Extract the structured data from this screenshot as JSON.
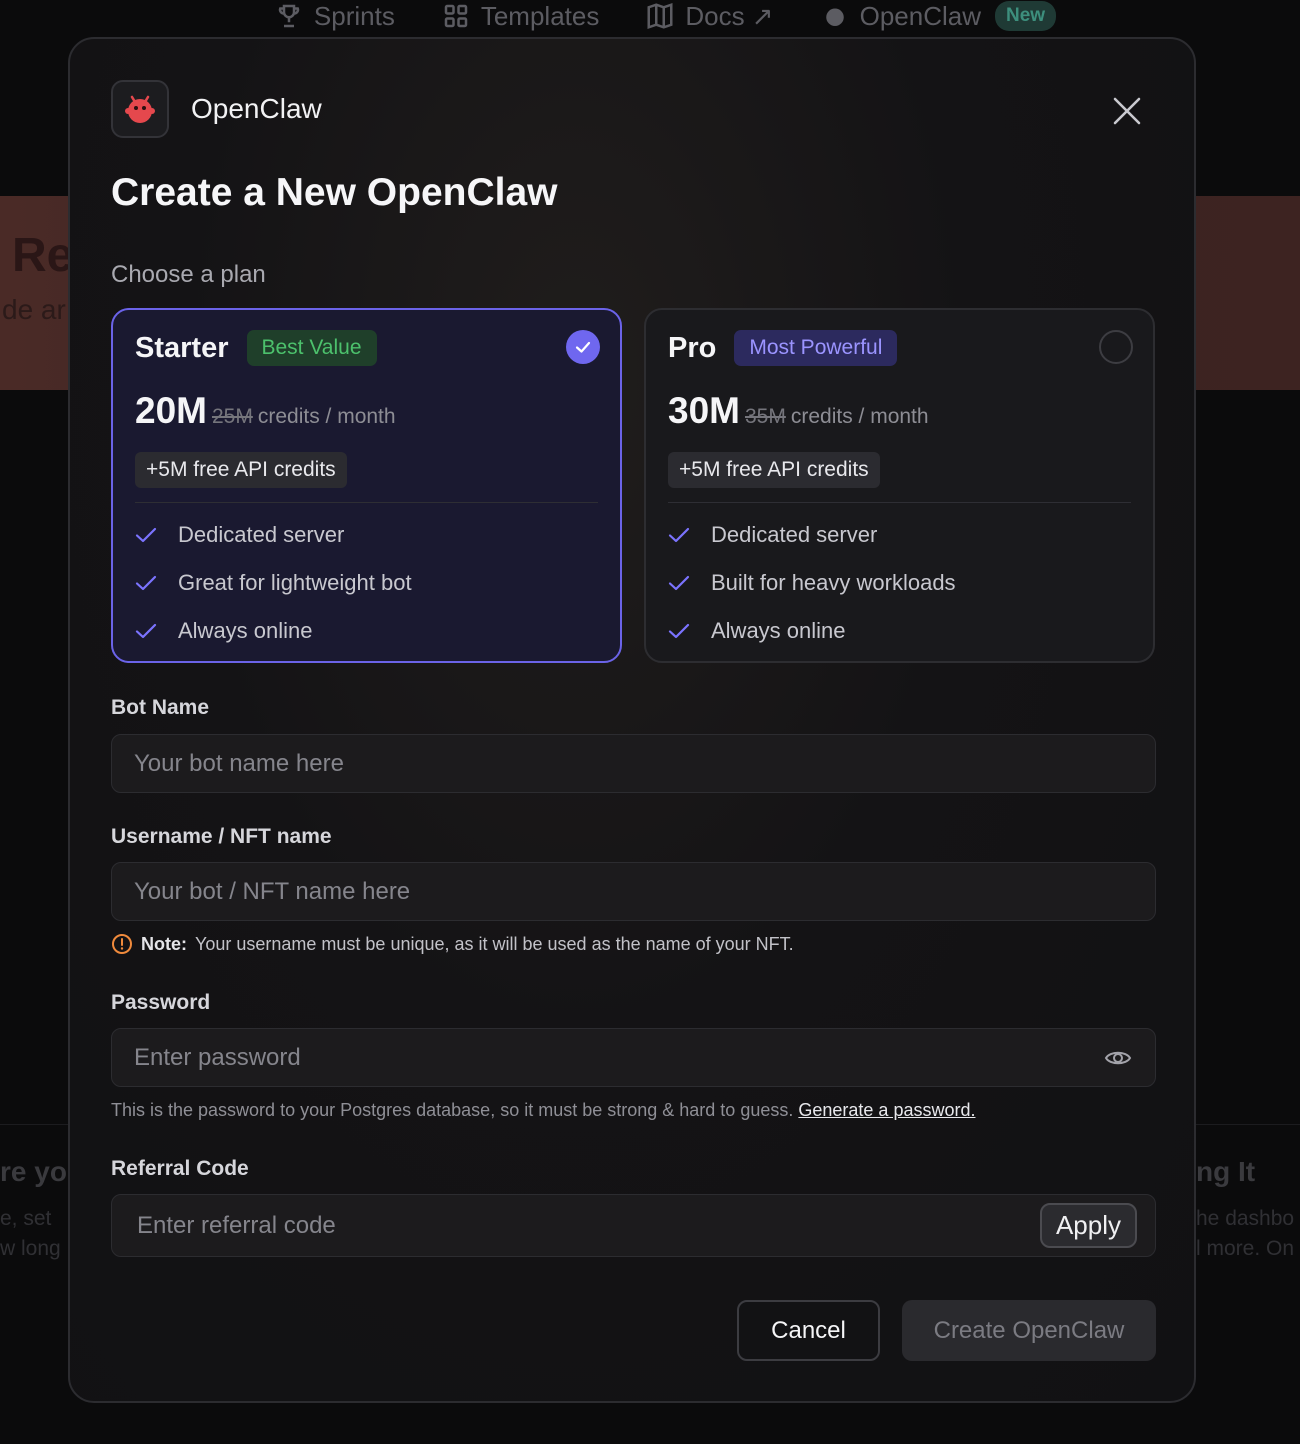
{
  "topnav": {
    "items": [
      {
        "label": "Sprints",
        "icon": "trophy-icon"
      },
      {
        "label": "Templates",
        "icon": "grid-icon"
      },
      {
        "label": "Docs ↗",
        "icon": "book-icon"
      },
      {
        "label": "OpenClaw",
        "icon": "bot-icon"
      }
    ],
    "new_badge": "New"
  },
  "background": {
    "title": "Re",
    "subtitle": "de ar",
    "left_heading": "re yo",
    "left_text": [
      "e, set",
      "w long"
    ],
    "right_heading": "ng It",
    "right_text": [
      "he dashbo",
      "l more. On"
    ]
  },
  "modal": {
    "app_name": "OpenClaw",
    "title": "Create a New OpenClaw",
    "plan_label": "Choose a plan",
    "plans": [
      {
        "name": "Starter",
        "badge": "Best Value",
        "selected": true,
        "credits": "20M",
        "old_credits": "25M",
        "unit": "credits / month",
        "api_bonus": "+5M free API credits",
        "features": [
          "Dedicated server",
          "Great for lightweight bot",
          "Always online"
        ]
      },
      {
        "name": "Pro",
        "badge": "Most Powerful",
        "selected": false,
        "credits": "30M",
        "old_credits": "35M",
        "unit": "credits / month",
        "api_bonus": "+5M free API credits",
        "features": [
          "Dedicated server",
          "Built for heavy workloads",
          "Always online"
        ]
      }
    ],
    "bot_name": {
      "label": "Bot Name",
      "placeholder": "Your bot name here",
      "value": ""
    },
    "username": {
      "label": "Username / NFT name",
      "placeholder": "Your bot / NFT name here",
      "value": "",
      "note_bold": "Note:",
      "note_text": "Your username must be unique, as it will be used as the name of your NFT."
    },
    "password": {
      "label": "Password",
      "placeholder": "Enter password",
      "value": "",
      "hint": "This is the password to your Postgres database, so it must be strong & hard to guess.",
      "generate_link": "Generate a password."
    },
    "referral": {
      "label": "Referral Code",
      "placeholder": "Enter referral code",
      "value": "",
      "apply_label": "Apply"
    },
    "cancel_label": "Cancel",
    "create_label": "Create OpenClaw"
  },
  "colors": {
    "accent": "#6b63e8",
    "badge_green": "#4cc16c",
    "badge_purple": "#9b94ff",
    "warning": "#f08a3c",
    "logo_red": "#e5484d"
  }
}
